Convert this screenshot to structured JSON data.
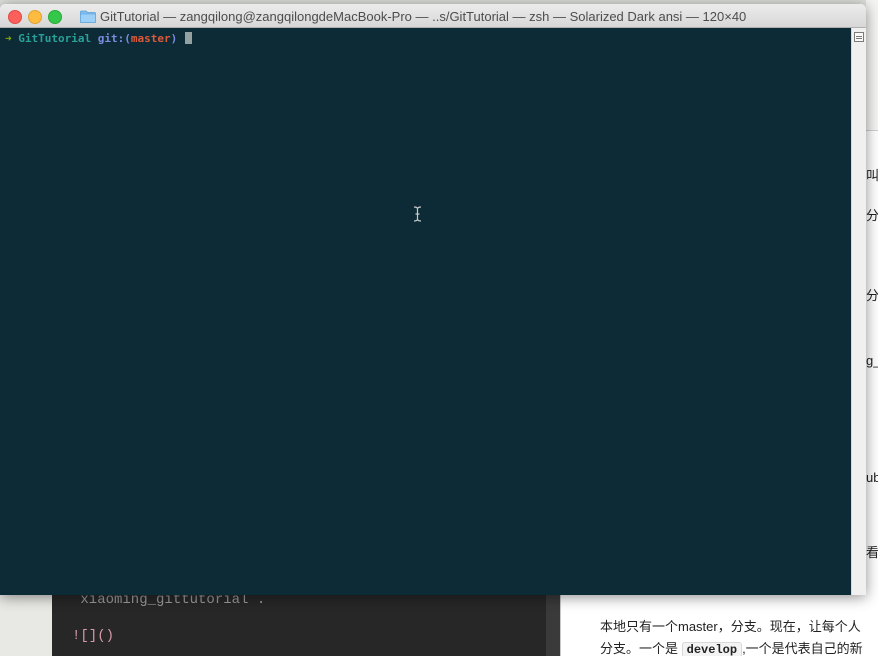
{
  "terminal": {
    "title": "GitTutorial — zangqilong@zangqilongdeMacBook-Pro — ..s/GitTutorial — zsh — Solarized Dark ansi — 120×40",
    "prompt_arrow": "➜",
    "prompt_dir": "GitTutorial",
    "prompt_git": "git:(",
    "prompt_branch": "master",
    "prompt_close": ")",
    "background_color": "#0d2b36",
    "icons": [
      "close-button",
      "minimize-button",
      "zoom-button",
      "folder-icon",
      "split-pane-icon",
      "ibeam-cursor-icon"
    ]
  },
  "background_editor": {
    "line1": "`xiaoming_gittutorial`.",
    "line2": "![]()"
  },
  "background_preview": {
    "edge_fragments": [
      "叫",
      "分",
      "分",
      "g_",
      "ub",
      "看"
    ],
    "para_line1": "本地只有一个master，分支。现在，让每个人",
    "para_line2_before": "分支。一个是",
    "para_line2_code": "develop",
    "para_line2_after": ",一个是代表自己的新"
  }
}
